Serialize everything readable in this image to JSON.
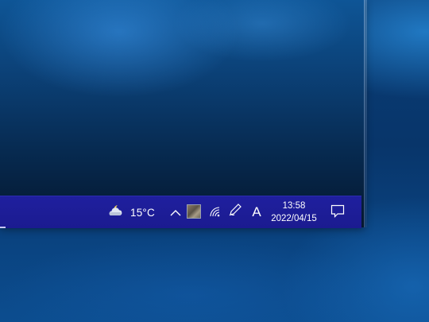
{
  "taskbar": {
    "weather": {
      "icon": "partly-cloudy-night-icon",
      "temperature": "15°C"
    },
    "tray_icons": [
      "show-hidden-icons-chevron-icon",
      "app-tray-icon",
      "wifi-icon",
      "pen-workspace-icon"
    ],
    "ime_indicator": "A",
    "clock": {
      "time": "13:58",
      "date": "2022/04/15"
    },
    "notification_icon": "action-center-icon"
  },
  "colors": {
    "taskbar_bg": "#1f1f9e",
    "desktop_bg": "#0a3f78",
    "text": "#ffffff"
  }
}
